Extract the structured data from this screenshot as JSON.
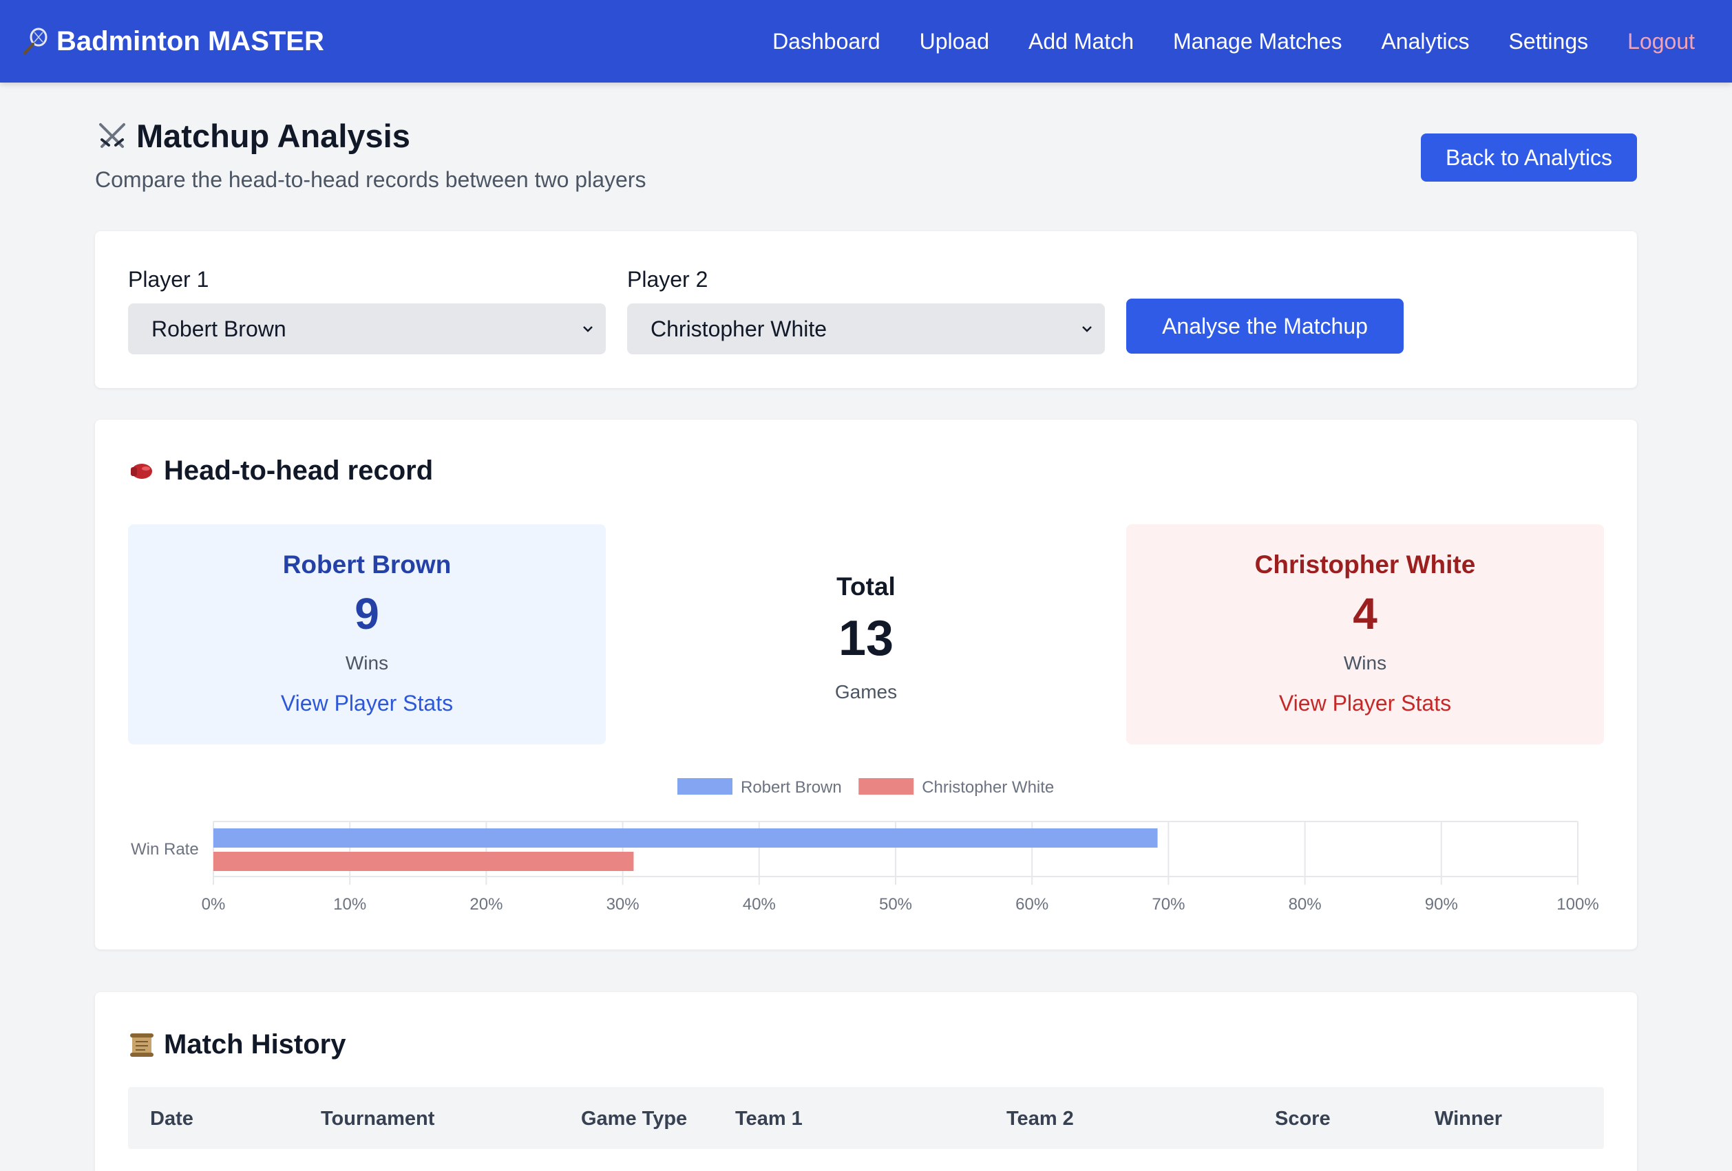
{
  "navbar": {
    "brand": "Badminton MASTER",
    "links": [
      "Dashboard",
      "Upload",
      "Add Match",
      "Manage Matches",
      "Analytics",
      "Settings"
    ],
    "logout": "Logout"
  },
  "header": {
    "title": "Matchup Analysis",
    "subtitle": "Compare the head-to-head records between two players",
    "back_button": "Back to Analytics"
  },
  "selection": {
    "player1_label": "Player 1",
    "player1_value": "Robert Brown",
    "player2_label": "Player 2",
    "player2_value": "Christopher White",
    "analyse_button": "Analyse the Matchup"
  },
  "head_to_head": {
    "title": "Head-to-head record",
    "player1": {
      "name": "Robert Brown",
      "wins": "9",
      "wins_label": "Wins",
      "link": "View Player Stats"
    },
    "player2": {
      "name": "Christopher White",
      "wins": "4",
      "wins_label": "Wins",
      "link": "View Player Stats"
    },
    "total": {
      "title": "Total",
      "count": "13",
      "label": "Games"
    }
  },
  "chart_data": {
    "type": "bar",
    "orientation": "horizontal",
    "categories": [
      "Win Rate"
    ],
    "series": [
      {
        "name": "Robert Brown",
        "values": [
          69.2
        ],
        "color": "#84a6f2"
      },
      {
        "name": "Christopher White",
        "values": [
          30.8
        ],
        "color": "#e98683"
      }
    ],
    "x_ticks": [
      "0%",
      "10%",
      "20%",
      "30%",
      "40%",
      "50%",
      "60%",
      "70%",
      "80%",
      "90%",
      "100%"
    ],
    "xlim": [
      0,
      100
    ],
    "legend_position": "top-center",
    "grid": true
  },
  "match_history": {
    "title": "Match History",
    "columns": [
      "Date",
      "Tournament",
      "Game Type",
      "Team 1",
      "Team 2",
      "Score",
      "Winner"
    ]
  },
  "colors": {
    "navbar": "#2d4fd4",
    "primary_button": "#2f5be7",
    "player1_accent": "#2441a8",
    "player2_accent": "#9b1f1f"
  }
}
